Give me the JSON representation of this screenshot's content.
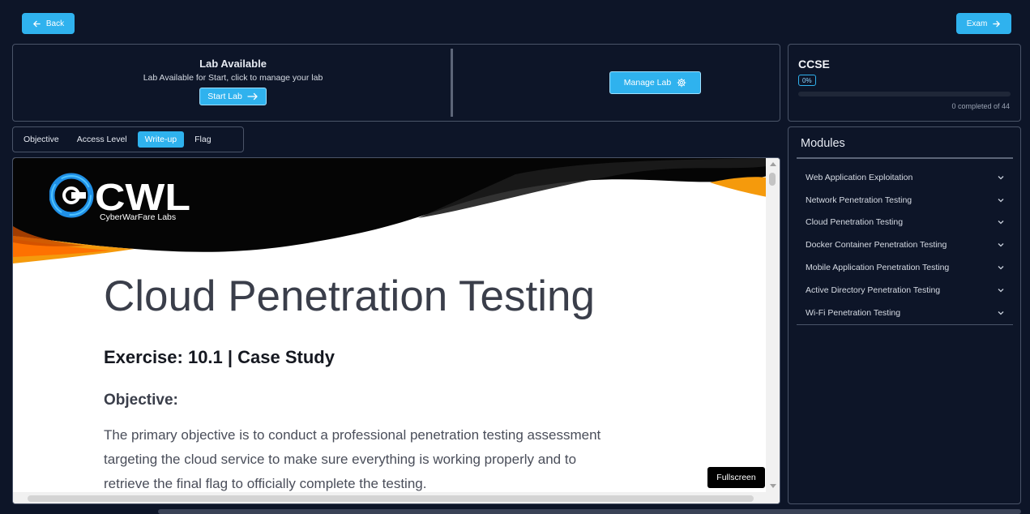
{
  "nav": {
    "back_label": "Back",
    "exam_label": "Exam"
  },
  "lab": {
    "title": "Lab Available",
    "subtitle": "Lab Available for Start, click to manage your lab",
    "start_label": "Start Lab",
    "manage_label": "Manage Lab"
  },
  "course": {
    "code": "CCSE",
    "percent_label": "0%",
    "progress_fraction": 0,
    "completed_text": "0 completed of 44"
  },
  "tabs": [
    {
      "label": "Objective",
      "active": false
    },
    {
      "label": "Access Level",
      "active": false
    },
    {
      "label": "Write-up",
      "active": true
    },
    {
      "label": "Flag",
      "active": false
    }
  ],
  "document": {
    "logo_text": "CWL",
    "logo_tagline": "CyberWarFare Labs",
    "title": "Cloud Penetration Testing",
    "exercise": "Exercise: 10.1 | Case Study",
    "objective_heading": "Objective:",
    "objective_lines": [
      "The primary objective is to conduct a professional penetration testing assessment",
      "targeting the cloud service to make sure everything is working properly and to",
      "retrieve the final flag to officially complete the testing."
    ],
    "fullscreen_label": "Fullscreen"
  },
  "modules": {
    "title": "Modules",
    "items": [
      "Web Application Exploitation",
      "Network Penetration Testing",
      "Cloud Penetration Testing",
      "Docker Container Penetration Testing",
      "Mobile Application Penetration Testing",
      "Active Directory Penetration Testing",
      "Wi-Fi Penetration Testing"
    ]
  },
  "colors": {
    "background": "#0d1528",
    "accent": "#2fb2ee",
    "border": "#4a5468",
    "banner_orange": "#f59a0c"
  }
}
